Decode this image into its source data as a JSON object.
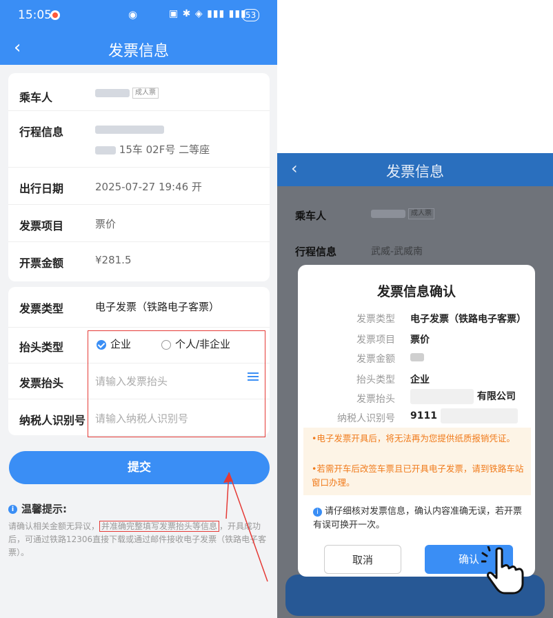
{
  "left": {
    "status": {
      "time": "15:05",
      "battery": "53"
    },
    "nav": {
      "back": "‹",
      "title": "发票信息"
    },
    "trip": {
      "passenger_label": "乘车人",
      "passenger_tag": "成人票",
      "itinerary_label": "行程信息",
      "itinerary_seat": "15车 02F号 二等座",
      "date_label": "出行日期",
      "date_value": "2025-07-27 19:46 开",
      "item_label": "发票项目",
      "item_value": "票价",
      "amount_label": "开票金额",
      "amount_value": "¥281.5"
    },
    "form": {
      "type_label": "发票类型",
      "type_value": "电子发票（铁路电子客票）",
      "header_type_label": "抬头类型",
      "option_company": "企业",
      "option_personal": "个人/非企业",
      "header_label": "发票抬头",
      "header_placeholder": "请输入发票抬头",
      "taxid_label": "纳税人识别号",
      "taxid_placeholder": "请输入纳税人识别号"
    },
    "submit_label": "提交",
    "tips": {
      "title": "温馨提示:",
      "body_a": "请确认相关金额无异议，",
      "body_highlight": "并准确完整填写发票抬头等信息",
      "body_b": "，开具成功后，可通过铁路12306直接下载或通过邮件接收电子发票（铁路电子客票）。"
    }
  },
  "right": {
    "nav": {
      "back": "‹",
      "title": "发票信息"
    },
    "bg": {
      "passenger_label": "乘车人",
      "passenger_tag": "成人票",
      "itinerary_label": "行程信息",
      "itinerary_value": "武威-武威南"
    },
    "dialog": {
      "title": "发票信息确认",
      "rows": [
        {
          "label": "发票类型",
          "value": "电子发票（铁路电子客票）"
        },
        {
          "label": "发票项目",
          "value": "票价"
        },
        {
          "label": "发票金额",
          "value": ""
        },
        {
          "label": "抬头类型",
          "value": "企业"
        },
        {
          "label": "发票抬头",
          "value": "有限公司"
        },
        {
          "label": "纳税人识别号",
          "value": "9111"
        }
      ],
      "warn1": "•电子发票开具后，将无法再为您提供纸质报销凭证。",
      "warn2": "•若需开车后改签车票且已开具电子发票，请到铁路车站窗口办理。",
      "confirm_text": "请仔细核对发票信息，确认内容准确无误，若开票有误可换开一次。",
      "cancel": "取消",
      "ok": "确认"
    }
  },
  "colors": {
    "primary": "#3a8ef5",
    "highlight": "#e53935",
    "warning": "#f07a1a"
  }
}
